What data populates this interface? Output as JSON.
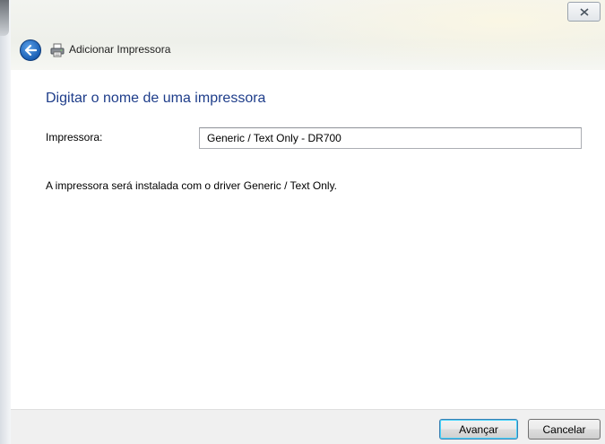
{
  "window": {
    "title": "Adicionar Impressora"
  },
  "page": {
    "heading": "Digitar o nome de uma impressora",
    "printer_field": {
      "label": "Impressora:",
      "value": "Generic / Text Only - DR700"
    },
    "info": "A impressora será instalada com o driver Generic / Text Only."
  },
  "footer": {
    "next_label": "Avançar",
    "cancel_label": "Cancelar"
  },
  "icons": {
    "back": "back-arrow-icon",
    "printer": "printer-icon",
    "close": "close-icon"
  },
  "colors": {
    "heading": "#1e3d8a",
    "back_button": "#1a5fb4",
    "footer_bg": "#f0f0f0"
  }
}
